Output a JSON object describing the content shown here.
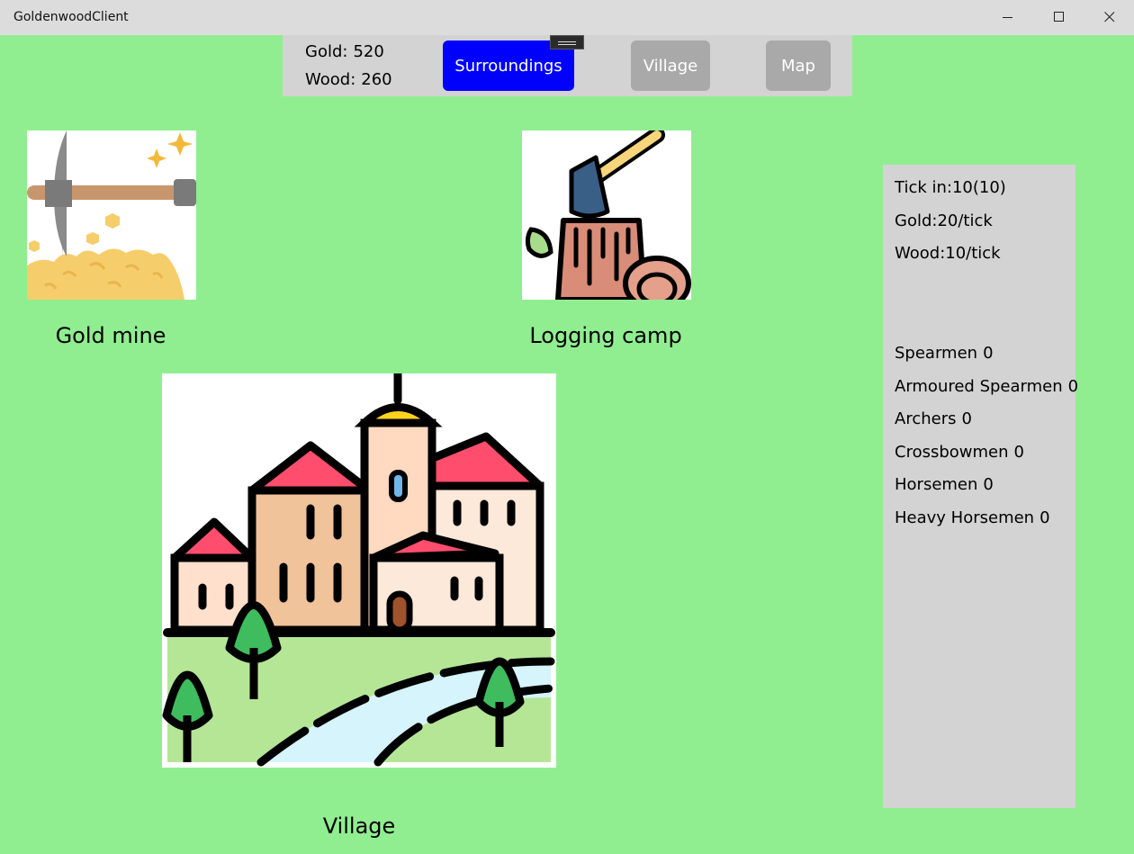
{
  "window": {
    "title": "GoldenwoodClient"
  },
  "resources": {
    "gold_label": "Gold:",
    "gold_value": "520",
    "wood_label": "Wood:",
    "wood_value": "260"
  },
  "nav": {
    "surroundings": "Surroundings",
    "village": "Village",
    "map": "Map",
    "active": "Surroundings"
  },
  "buildings": {
    "gold_mine": "Gold mine",
    "logging_camp": "Logging camp",
    "village": "Village"
  },
  "stats": {
    "tick": "Tick in:10(10)",
    "gold_rate": "Gold:20/tick",
    "wood_rate": "Wood:10/tick"
  },
  "units": [
    {
      "name": "Spearmen",
      "count": "0"
    },
    {
      "name": "Armoured Spearmen",
      "count": "0"
    },
    {
      "name": "Archers",
      "count": "0"
    },
    {
      "name": "Crossbowmen",
      "count": "0"
    },
    {
      "name": "Horsemen",
      "count": "0"
    },
    {
      "name": "Heavy Horsemen",
      "count": "0"
    }
  ],
  "colors": {
    "background": "#90ee90",
    "panel": "#d3d3d3",
    "active_button": "#0000ff",
    "inactive_button": "#a9a9a9"
  }
}
